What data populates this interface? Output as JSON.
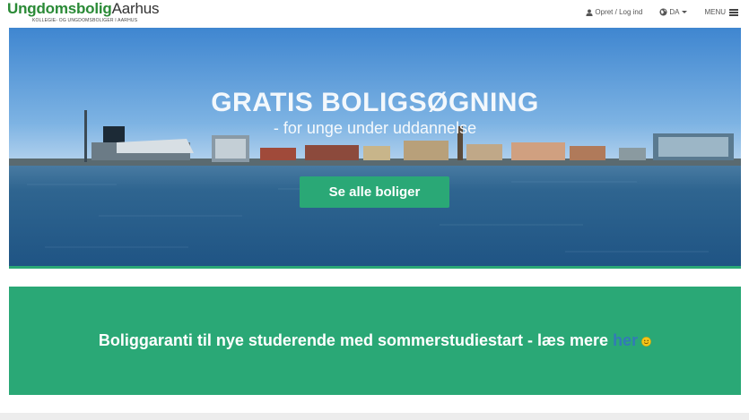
{
  "header": {
    "logo_bold": "Ungdomsbolig",
    "logo_light": "Aarhus",
    "logo_tagline": "KOLLEGIE- OG UNGDOMSBOLIGER I AARHUS",
    "login_label": "Opret / Log ind",
    "login_icon": "user-icon",
    "language_label": "DA",
    "language_icon": "globe-icon",
    "menu_label": "MENU",
    "menu_icon": "hamburger-icon"
  },
  "hero": {
    "title": "GRATIS BOLIGSØGNING",
    "subtitle": "- for unge under uddannelse",
    "button_label": "Se alle boliger"
  },
  "banner": {
    "text": "Boliggaranti til nye studerende med sommerstudiestart - læs mere ",
    "link_label": "her",
    "emoji_icon": "smiley-icon"
  },
  "colors": {
    "brand_green": "#2aa876",
    "logo_green": "#2a8a36",
    "link_blue": "#337ab7"
  }
}
